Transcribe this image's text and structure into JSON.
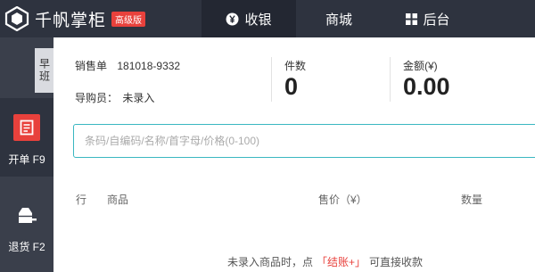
{
  "header": {
    "app_name": "千帆掌柜",
    "edition_badge": "高级版",
    "tabs": [
      {
        "label": "收银",
        "icon": "yen-coin-icon",
        "active": true
      },
      {
        "label": "商城",
        "active": false
      },
      {
        "label": "后台",
        "icon": "grid-icon",
        "active": false
      }
    ]
  },
  "sidebar": {
    "shift": "早班",
    "items": [
      {
        "label": "开单 F9",
        "icon": "receipt-icon",
        "active": true
      },
      {
        "label": "退货 F2",
        "icon": "return-box-icon",
        "active": false
      }
    ]
  },
  "sale": {
    "order_label": "销售单",
    "order_no": "181018-9332",
    "guide_label": "导购员：",
    "guide_value": "未录入",
    "count_label": "件数",
    "count_value": "0",
    "amount_label": "金额(¥)",
    "amount_value": "0.00"
  },
  "search": {
    "placeholder": "条码/自编码/名称/首字母/价格(0-100)"
  },
  "table": {
    "columns": [
      "行",
      "商品",
      "售价（¥）",
      "数量"
    ]
  },
  "hint": {
    "before": "未录入商品时，点",
    "action": "「结账+」",
    "after": "可直接收款"
  },
  "colors": {
    "topbar": "#2e333f",
    "sidebar": "#3a3f4b",
    "accent_red": "#e8413c",
    "search_border": "#3ab7c1"
  }
}
